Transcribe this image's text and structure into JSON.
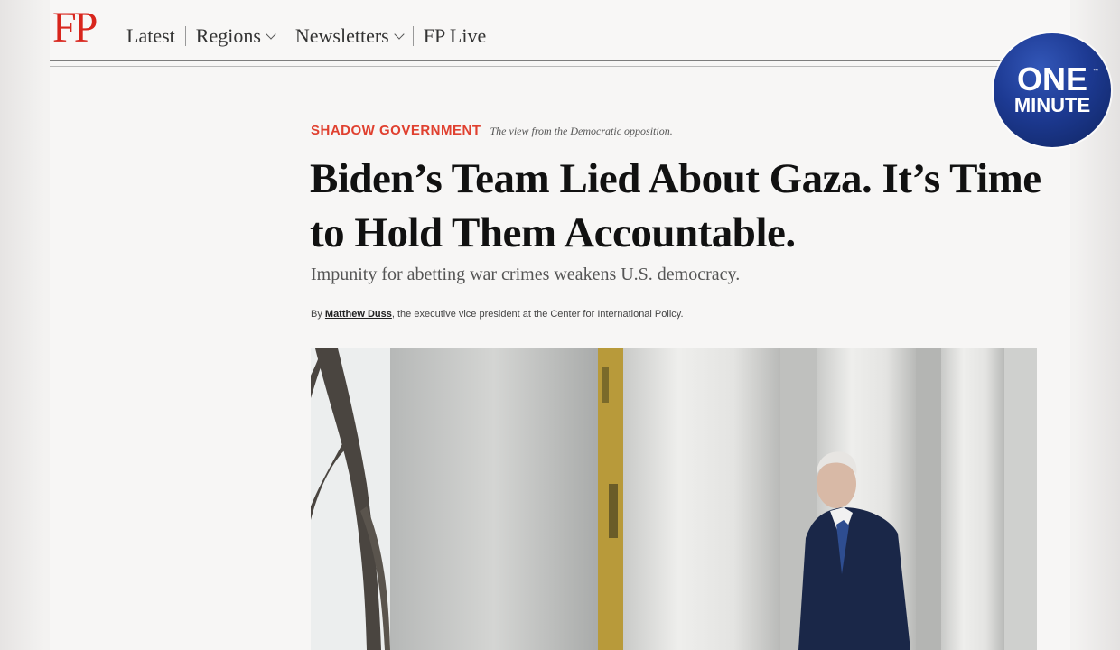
{
  "site": {
    "logo": "FP",
    "nav": [
      {
        "label": "Latest"
      },
      {
        "label": "Regions"
      },
      {
        "label": "Newsletters"
      },
      {
        "label": "FP Live"
      }
    ]
  },
  "badge": {
    "line1": "ONE",
    "line2": "MINUTE",
    "trademark": "™",
    "color": "#1d3a93"
  },
  "article": {
    "section": "SHADOW GOVERNMENT",
    "section_tagline": "The view from the Democratic opposition.",
    "headline": "Biden’s Team Lied About Gaza. It’s Time to Hold Them Accountable.",
    "dek": "Impunity for abetting war crimes weakens U.S. democracy.",
    "byline_prefix": "By ",
    "author": "Matthew Duss",
    "author_description": ", the executive vice president at the Center for International Policy."
  },
  "colors": {
    "brand_red": "#d8261d",
    "kicker_red": "#e0402f",
    "text_dark": "#111111"
  },
  "icons": [
    "chevron-down-icon"
  ]
}
